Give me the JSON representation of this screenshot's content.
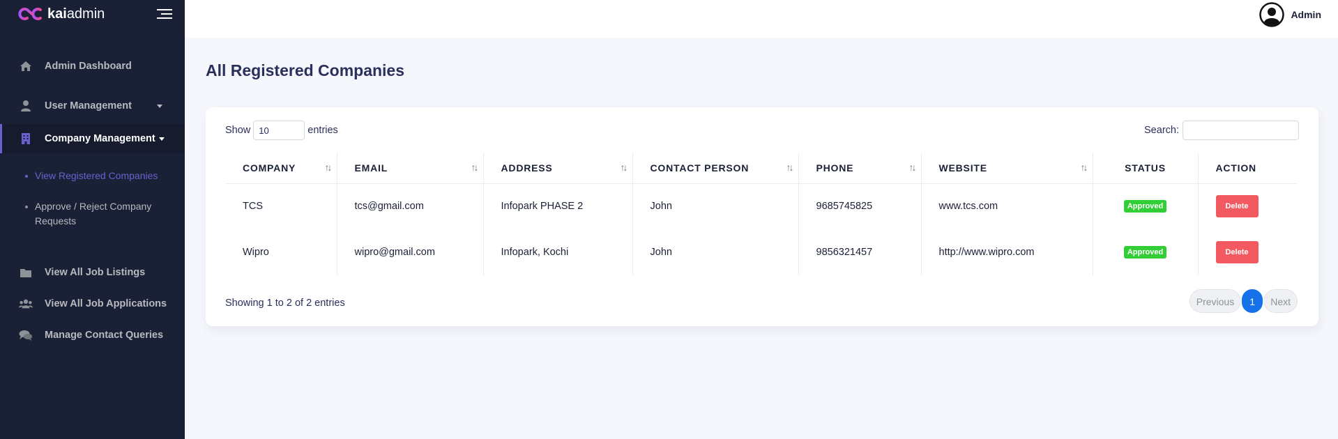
{
  "brand": {
    "bold": "kai",
    "rest": "admin"
  },
  "header": {
    "user_name": "Admin"
  },
  "sidebar": {
    "items": [
      {
        "label": "Admin Dashboard",
        "icon": "home-icon"
      },
      {
        "label": "User Management",
        "icon": "user-icon"
      },
      {
        "label": "Company Management",
        "icon": "building-icon"
      },
      {
        "label": "View All Job Listings",
        "icon": "folder-icon"
      },
      {
        "label": "View All Job Applications",
        "icon": "users-icon"
      },
      {
        "label": "Manage Contact Queries",
        "icon": "comments-icon"
      }
    ],
    "sub_items": [
      {
        "label": "View Registered Companies"
      },
      {
        "label": "Approve / Reject Company Requests"
      }
    ]
  },
  "page": {
    "title": "All Registered Companies"
  },
  "table_controls": {
    "show_label": "Show",
    "entries_value": "10",
    "entries_label": "entries",
    "search_label": "Search:",
    "search_value": ""
  },
  "table": {
    "columns": [
      "COMPANY",
      "EMAIL",
      "ADDRESS",
      "CONTACT PERSON",
      "PHONE",
      "WEBSITE",
      "STATUS",
      "ACTION"
    ],
    "rows": [
      {
        "company": "TCS",
        "email": "tcs@gmail.com",
        "address": "Infopark PHASE 2",
        "contact": "John",
        "phone": "9685745825",
        "website": "www.tcs.com",
        "status": "Approved",
        "action": "Delete"
      },
      {
        "company": "Wipro",
        "email": "wipro@gmail.com",
        "address": "Infopark, Kochi",
        "contact": "John",
        "phone": "9856321457",
        "website": "http://www.wipro.com",
        "status": "Approved",
        "action": "Delete"
      }
    ]
  },
  "pagination": {
    "info": "Showing 1 to 2 of 2 entries",
    "previous": "Previous",
    "current": "1",
    "next": "Next"
  },
  "colors": {
    "sidebar_bg": "#1a2035",
    "accent": "#6861ce",
    "success": "#31ce36",
    "danger": "#f25961",
    "primary": "#1572e8"
  }
}
